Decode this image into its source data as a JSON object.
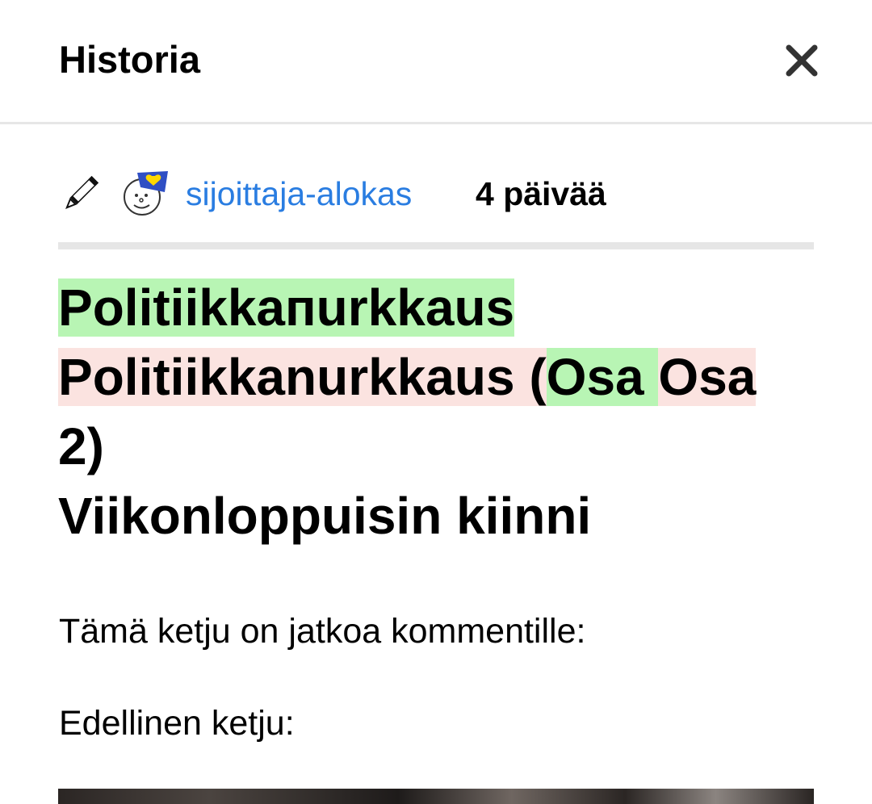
{
  "header": {
    "title": "Historia",
    "close_icon": "close-icon"
  },
  "revision": {
    "edit_icon": "pencil-icon",
    "avatar_icon": "smiley-with-cap-avatar",
    "username": "sijoittaja-alokas",
    "time_ago": "4 päivää",
    "username_color": "#2a7de1"
  },
  "title_diff": {
    "inserted_title": "Politiikkaпurkkaus",
    "deleted_title": "Politiikkanurkkaus",
    "open_paren": " (",
    "inserted_osa": "Osa ",
    "deleted_osa": "Osa",
    "part_number": "2)",
    "subtitle": "Viikonloppuisin kiinni",
    "inserted_color": "#b8f5b4",
    "deleted_color": "#fbe3e0"
  },
  "content": {
    "paragraph_1": "Tämä ketju on jatkoa kommentille:",
    "paragraph_2": "Edellinen ketju:"
  }
}
